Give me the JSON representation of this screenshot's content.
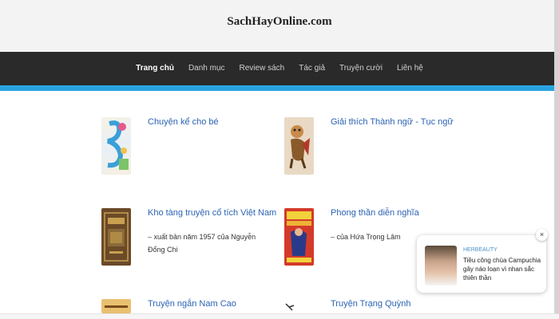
{
  "site": {
    "title": "SachHayOnline.com"
  },
  "nav": {
    "items": [
      {
        "label": "Trang chủ",
        "active": true
      },
      {
        "label": "Danh mục",
        "active": false
      },
      {
        "label": "Review sách",
        "active": false
      },
      {
        "label": "Tác giả",
        "active": false
      },
      {
        "label": "Truyện cười",
        "active": false
      },
      {
        "label": "Liên hệ",
        "active": false
      }
    ]
  },
  "books": [
    {
      "title": "Chuyện kể cho bé",
      "desc": ""
    },
    {
      "title": "Giải thích Thành ngữ - Tục ngữ",
      "desc": ""
    },
    {
      "title": "Kho tàng truyện cổ tích Việt Nam",
      "desc": "– xuất bản năm 1957 của Nguyễn Đổng Chi"
    },
    {
      "title": "Phong thần diễn nghĩa",
      "desc": "– của Hứa Trọng Lâm"
    },
    {
      "title": "Truyện ngắn Nam Cao",
      "desc": ""
    },
    {
      "title": "Truyện Trạng Quỳnh",
      "desc": ""
    }
  ],
  "ad": {
    "brand": "HERBEAUTY",
    "text": "Tiều công chúa Campuchia gây náo loạn vì nhan sắc thiên thần",
    "close": "×"
  }
}
